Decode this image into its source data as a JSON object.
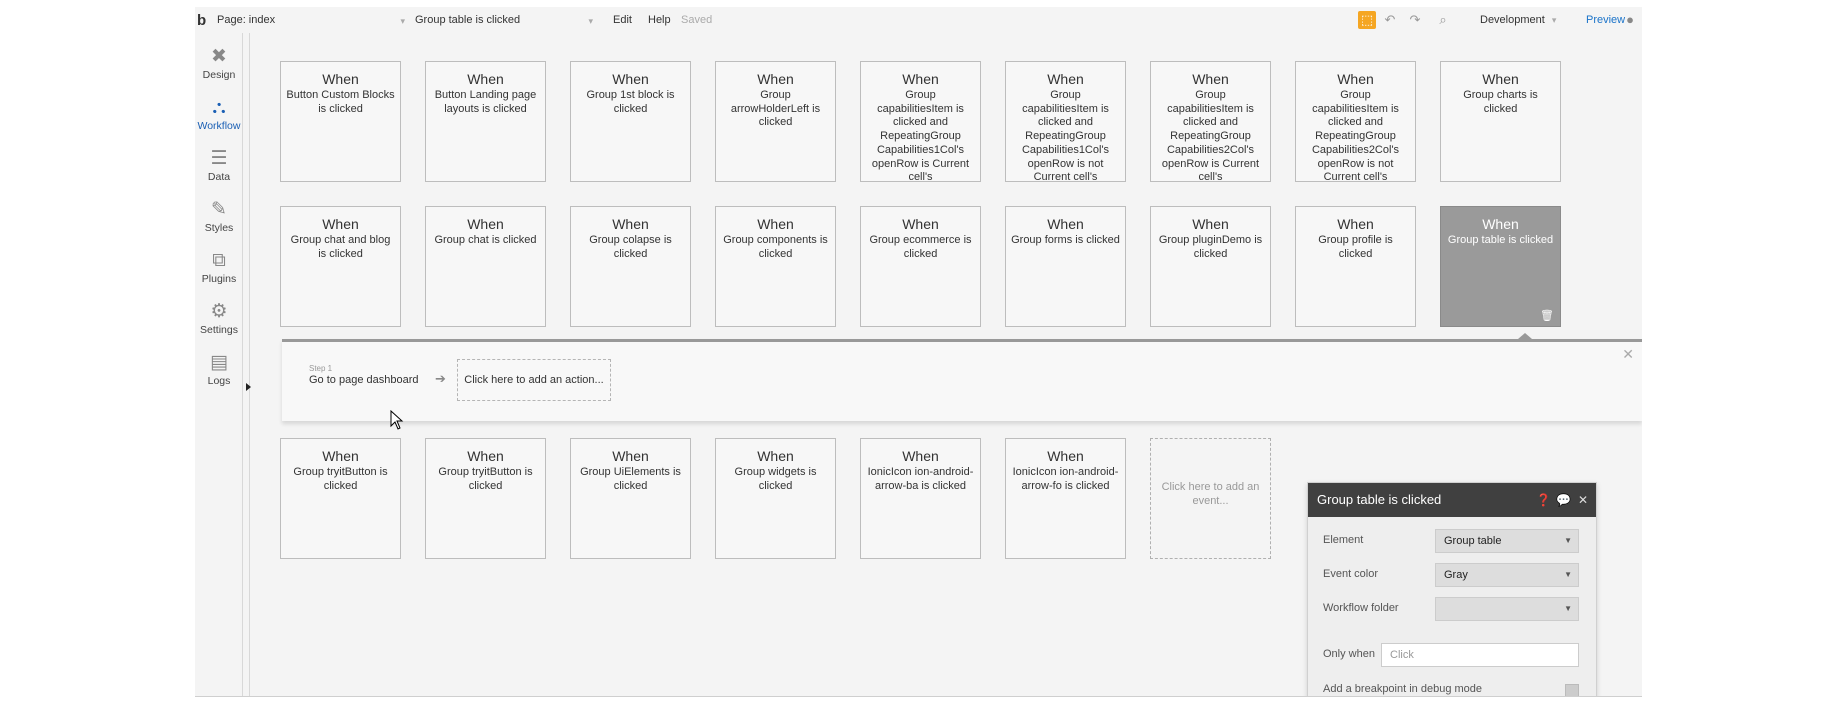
{
  "topbar": {
    "logo": "b",
    "page_selector": "Page: index",
    "event_selector": "Group table is clicked",
    "menu_edit": "Edit",
    "menu_help": "Help",
    "saved_status": "Saved",
    "environment": "Development",
    "preview_label": "Preview"
  },
  "sidebar": {
    "items": [
      {
        "label": "Design",
        "icon": "design-icon"
      },
      {
        "label": "Workflow",
        "icon": "workflow-icon"
      },
      {
        "label": "Data",
        "icon": "data-icon"
      },
      {
        "label": "Styles",
        "icon": "styles-icon"
      },
      {
        "label": "Plugins",
        "icon": "plugins-icon"
      },
      {
        "label": "Settings",
        "icon": "settings-icon"
      },
      {
        "label": "Logs",
        "icon": "logs-icon"
      }
    ]
  },
  "events": {
    "when_label": "When",
    "row1": [
      "Button Custom Blocks is clicked",
      "Button Landing page layouts is clicked",
      "Group 1st block is clicked",
      "Group arrowHolderLeft is clicked",
      "Group capabilitiesItem is clicked and RepeatingGroup Capabilities1Col's openRow is Current cell's AdvantagesFirstCol's",
      "Group capabilitiesItem is clicked and RepeatingGroup Capabilities1Col's openRow is not Current cell's AdvantagesFirstCol's",
      "Group capabilitiesItem is clicked and RepeatingGroup Capabilities2Col's openRow is Current cell's AdvantagesSecondCol's",
      "Group capabilitiesItem is clicked and RepeatingGroup Capabilities2Col's openRow is not Current cell's AdvantagesSecondCol's",
      "Group charts is clicked"
    ],
    "row2": [
      "Group chat and blog is clicked",
      "Group chat is clicked",
      "Group colapse is clicked",
      "Group components is clicked",
      "Group ecommerce is clicked",
      "Group forms is clicked",
      "Group pluginDemo is clicked",
      "Group profile is clicked",
      "Group table is clicked"
    ],
    "row3": [
      "Group tryitButton is clicked",
      "Group tryitButton is clicked",
      "Group UiElements is clicked",
      "Group widgets is clicked",
      "IonicIcon ion-android-arrow-ba is clicked",
      "IonicIcon ion-android-arrow-fo is clicked"
    ],
    "add_event": "Click here to add an event..."
  },
  "actions": {
    "step_label": "Step 1",
    "step_name": "Go to page dashboard",
    "add_action": "Click here to add an action..."
  },
  "properties": {
    "title": "Group table is clicked",
    "element_label": "Element",
    "element_value": "Group table",
    "event_color_label": "Event color",
    "event_color_value": "Gray",
    "workflow_folder_label": "Workflow folder",
    "workflow_folder_value": "",
    "only_when_label": "Only when",
    "only_when_placeholder": "Click",
    "breakpoint_label": "Add a breakpoint in debug mode"
  },
  "colors": {
    "accent_blue": "#1a5fb4",
    "selected_card": "#9a9a9a",
    "orange_icon": "#f5a623",
    "panel_header": "#404040"
  }
}
